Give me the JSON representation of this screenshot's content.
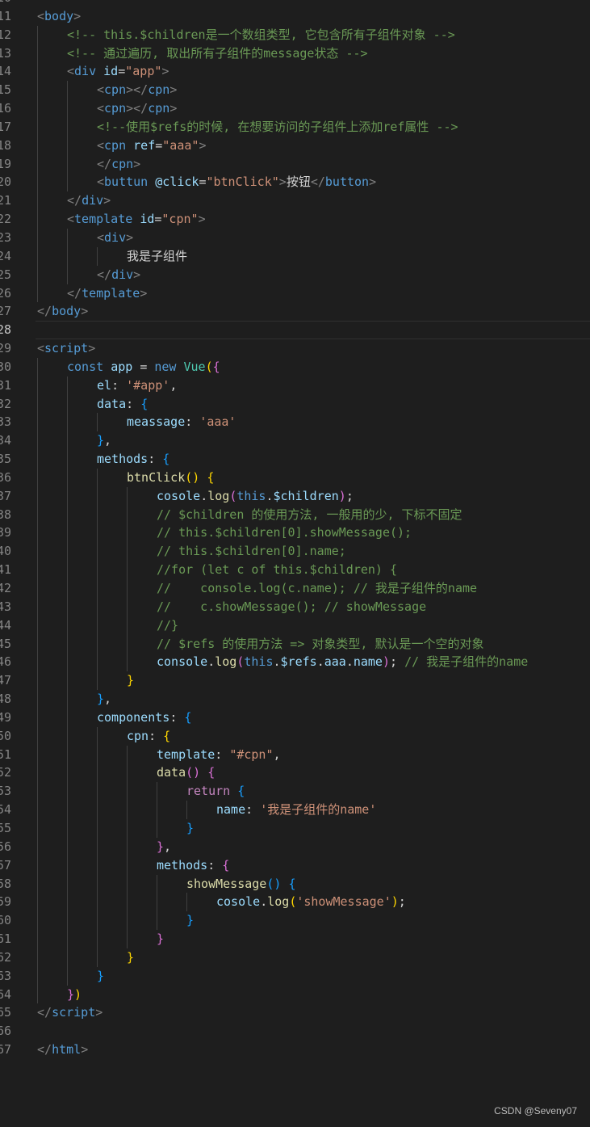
{
  "editor": {
    "language": "html",
    "theme_colors": {
      "background": "#1e1e1e",
      "line_number": "#858585",
      "tag_bracket": "#808080",
      "tag_name": "#569cd6",
      "attribute": "#9cdcfe",
      "string": "#ce9178",
      "comment": "#6a9955",
      "function": "#dcdcaa",
      "bracket_level_1": "#ffd700",
      "bracket_level_2": "#da70d6",
      "bracket_level_3": "#179fff"
    },
    "lines": [
      {
        "n": "10",
        "indent": 0,
        "tokens": []
      },
      {
        "n": "11",
        "indent": 0,
        "tokens": [
          [
            "tag",
            "<"
          ],
          [
            "tn",
            "body"
          ],
          [
            "tag",
            ">"
          ]
        ]
      },
      {
        "n": "12",
        "indent": 1,
        "tokens": [
          [
            "cm",
            "<!-- this.$children是一个数组类型, 它包含所有子组件对象 -->"
          ]
        ]
      },
      {
        "n": "13",
        "indent": 1,
        "tokens": [
          [
            "cm",
            "<!-- 通过遍历, 取出所有子组件的message状态 -->"
          ]
        ]
      },
      {
        "n": "14",
        "indent": 1,
        "tokens": [
          [
            "tag",
            "<"
          ],
          [
            "tn",
            "div"
          ],
          [
            "tx",
            " "
          ],
          [
            "an",
            "id"
          ],
          [
            "pn",
            "="
          ],
          [
            "av",
            "\"app\""
          ],
          [
            "tag",
            ">"
          ]
        ]
      },
      {
        "n": "15",
        "indent": 2,
        "tokens": [
          [
            "tag",
            "<"
          ],
          [
            "tn",
            "cpn"
          ],
          [
            "tag",
            "></"
          ],
          [
            "tn",
            "cpn"
          ],
          [
            "tag",
            ">"
          ]
        ]
      },
      {
        "n": "16",
        "indent": 2,
        "tokens": [
          [
            "tag",
            "<"
          ],
          [
            "tn",
            "cpn"
          ],
          [
            "tag",
            "></"
          ],
          [
            "tn",
            "cpn"
          ],
          [
            "tag",
            ">"
          ]
        ]
      },
      {
        "n": "17",
        "indent": 2,
        "tokens": [
          [
            "cm",
            "<!--使用$refs的时候, 在想要访问的子组件上添加ref属性 -->"
          ]
        ]
      },
      {
        "n": "18",
        "indent": 2,
        "tokens": [
          [
            "tag",
            "<"
          ],
          [
            "tn",
            "cpn"
          ],
          [
            "tx",
            " "
          ],
          [
            "an",
            "ref"
          ],
          [
            "pn",
            "="
          ],
          [
            "av",
            "\"aaa\""
          ],
          [
            "tag",
            ">"
          ]
        ]
      },
      {
        "n": "19",
        "indent": 2,
        "tokens": [
          [
            "tag",
            "</"
          ],
          [
            "tn",
            "cpn"
          ],
          [
            "tag",
            ">"
          ]
        ]
      },
      {
        "n": "20",
        "indent": 2,
        "tokens": [
          [
            "tag",
            "<"
          ],
          [
            "tn",
            "buttun"
          ],
          [
            "tx",
            " "
          ],
          [
            "an",
            "@click"
          ],
          [
            "pn",
            "="
          ],
          [
            "av",
            "\"btnClick\""
          ],
          [
            "tag",
            ">"
          ],
          [
            "tx",
            "按钮"
          ],
          [
            "tag",
            "</"
          ],
          [
            "tn",
            "button"
          ],
          [
            "tag",
            ">"
          ]
        ]
      },
      {
        "n": "21",
        "indent": 1,
        "tokens": [
          [
            "tag",
            "</"
          ],
          [
            "tn",
            "div"
          ],
          [
            "tag",
            ">"
          ]
        ]
      },
      {
        "n": "22",
        "indent": 1,
        "tokens": [
          [
            "tag",
            "<"
          ],
          [
            "tn",
            "template"
          ],
          [
            "tx",
            " "
          ],
          [
            "an",
            "id"
          ],
          [
            "pn",
            "="
          ],
          [
            "av",
            "\"cpn\""
          ],
          [
            "tag",
            ">"
          ]
        ]
      },
      {
        "n": "23",
        "indent": 2,
        "tokens": [
          [
            "tag",
            "<"
          ],
          [
            "tn",
            "div"
          ],
          [
            "tag",
            ">"
          ]
        ]
      },
      {
        "n": "24",
        "indent": 3,
        "tokens": [
          [
            "tx",
            "我是子组件"
          ]
        ]
      },
      {
        "n": "25",
        "indent": 2,
        "tokens": [
          [
            "tag",
            "</"
          ],
          [
            "tn",
            "div"
          ],
          [
            "tag",
            ">"
          ]
        ]
      },
      {
        "n": "26",
        "indent": 1,
        "tokens": [
          [
            "tag",
            "</"
          ],
          [
            "tn",
            "template"
          ],
          [
            "tag",
            ">"
          ]
        ]
      },
      {
        "n": "27",
        "indent": 0,
        "tokens": [
          [
            "tag",
            "</"
          ],
          [
            "tn",
            "body"
          ],
          [
            "tag",
            ">"
          ]
        ]
      },
      {
        "n": "28",
        "indent": 0,
        "active": true,
        "tokens": []
      },
      {
        "n": "29",
        "indent": 0,
        "tokens": [
          [
            "tag",
            "<"
          ],
          [
            "tn",
            "script"
          ],
          [
            "tag",
            ">"
          ]
        ]
      },
      {
        "n": "30",
        "indent": 1,
        "tokens": [
          [
            "kw",
            "const"
          ],
          [
            "tx",
            " "
          ],
          [
            "vr",
            "app"
          ],
          [
            "tx",
            " "
          ],
          [
            "pn",
            "="
          ],
          [
            "tx",
            " "
          ],
          [
            "kw",
            "new"
          ],
          [
            "tx",
            " "
          ],
          [
            "cl",
            "Vue"
          ],
          [
            "b1",
            "("
          ],
          [
            "b2",
            "{"
          ]
        ]
      },
      {
        "n": "31",
        "indent": 2,
        "tokens": [
          [
            "vr",
            "el"
          ],
          [
            "pn",
            ": "
          ],
          [
            "st",
            "'#app'"
          ],
          [
            "pn",
            ","
          ]
        ]
      },
      {
        "n": "32",
        "indent": 2,
        "tokens": [
          [
            "vr",
            "data"
          ],
          [
            "pn",
            ": "
          ],
          [
            "b3",
            "{"
          ]
        ]
      },
      {
        "n": "33",
        "indent": 3,
        "tokens": [
          [
            "vr",
            "meassage"
          ],
          [
            "pn",
            ": "
          ],
          [
            "st",
            "'aaa'"
          ]
        ]
      },
      {
        "n": "34",
        "indent": 2,
        "tokens": [
          [
            "b3",
            "}"
          ],
          [
            "pn",
            ","
          ]
        ]
      },
      {
        "n": "35",
        "indent": 2,
        "tokens": [
          [
            "vr",
            "methods"
          ],
          [
            "pn",
            ": "
          ],
          [
            "b3",
            "{"
          ]
        ]
      },
      {
        "n": "36",
        "indent": 3,
        "tokens": [
          [
            "fn",
            "btnClick"
          ],
          [
            "b1",
            "()"
          ],
          [
            "tx",
            " "
          ],
          [
            "b1",
            "{"
          ]
        ]
      },
      {
        "n": "37",
        "indent": 4,
        "tokens": [
          [
            "vr",
            "cosole"
          ],
          [
            "pn",
            "."
          ],
          [
            "fn",
            "log"
          ],
          [
            "b2",
            "("
          ],
          [
            "kw",
            "this"
          ],
          [
            "pn",
            "."
          ],
          [
            "vr",
            "$children"
          ],
          [
            "b2",
            ")"
          ],
          [
            "pn",
            ";"
          ]
        ]
      },
      {
        "n": "38",
        "indent": 4,
        "tokens": [
          [
            "cm",
            "// $children 的使用方法, 一般用的少, 下标不固定"
          ]
        ]
      },
      {
        "n": "39",
        "indent": 4,
        "tokens": [
          [
            "cm",
            "// this.$children[0].showMessage();"
          ]
        ]
      },
      {
        "n": "40",
        "indent": 4,
        "tokens": [
          [
            "cm",
            "// this.$children[0].name;"
          ]
        ]
      },
      {
        "n": "41",
        "indent": 4,
        "tokens": [
          [
            "cm",
            "//for (let c of this.$children) {"
          ]
        ]
      },
      {
        "n": "42",
        "indent": 4,
        "tokens": [
          [
            "cm",
            "//    console.log(c.name); // 我是子组件的name"
          ]
        ]
      },
      {
        "n": "43",
        "indent": 4,
        "tokens": [
          [
            "cm",
            "//    c.showMessage(); // showMessage"
          ]
        ]
      },
      {
        "n": "44",
        "indent": 4,
        "tokens": [
          [
            "cm",
            "//}"
          ]
        ]
      },
      {
        "n": "45",
        "indent": 4,
        "tokens": [
          [
            "cm",
            "// $refs 的使用方法 => 对象类型, 默认是一个空的对象"
          ]
        ]
      },
      {
        "n": "46",
        "indent": 4,
        "tokens": [
          [
            "vr",
            "console"
          ],
          [
            "pn",
            "."
          ],
          [
            "fn",
            "log"
          ],
          [
            "b2",
            "("
          ],
          [
            "kw",
            "this"
          ],
          [
            "pn",
            "."
          ],
          [
            "vr",
            "$refs"
          ],
          [
            "pn",
            "."
          ],
          [
            "vr",
            "aaa"
          ],
          [
            "pn",
            "."
          ],
          [
            "vr",
            "name"
          ],
          [
            "b2",
            ")"
          ],
          [
            "pn",
            "; "
          ],
          [
            "cm",
            "// 我是子组件的name"
          ]
        ]
      },
      {
        "n": "47",
        "indent": 3,
        "tokens": [
          [
            "b1",
            "}"
          ]
        ]
      },
      {
        "n": "48",
        "indent": 2,
        "tokens": [
          [
            "b3",
            "}"
          ],
          [
            "pn",
            ","
          ]
        ]
      },
      {
        "n": "49",
        "indent": 2,
        "tokens": [
          [
            "vr",
            "components"
          ],
          [
            "pn",
            ": "
          ],
          [
            "b3",
            "{"
          ]
        ]
      },
      {
        "n": "50",
        "indent": 3,
        "tokens": [
          [
            "vr",
            "cpn"
          ],
          [
            "pn",
            ": "
          ],
          [
            "b1",
            "{"
          ]
        ]
      },
      {
        "n": "51",
        "indent": 4,
        "tokens": [
          [
            "vr",
            "template"
          ],
          [
            "pn",
            ": "
          ],
          [
            "st",
            "\"#cpn\""
          ],
          [
            "pn",
            ","
          ]
        ]
      },
      {
        "n": "52",
        "indent": 4,
        "tokens": [
          [
            "fn",
            "data"
          ],
          [
            "b2",
            "()"
          ],
          [
            "tx",
            " "
          ],
          [
            "b2",
            "{"
          ]
        ]
      },
      {
        "n": "53",
        "indent": 5,
        "tokens": [
          [
            "kc",
            "return"
          ],
          [
            "tx",
            " "
          ],
          [
            "b3",
            "{"
          ]
        ]
      },
      {
        "n": "54",
        "indent": 6,
        "tokens": [
          [
            "vr",
            "name"
          ],
          [
            "pn",
            ": "
          ],
          [
            "st",
            "'我是子组件的name'"
          ]
        ]
      },
      {
        "n": "55",
        "indent": 5,
        "tokens": [
          [
            "b3",
            "}"
          ]
        ]
      },
      {
        "n": "56",
        "indent": 4,
        "tokens": [
          [
            "b2",
            "}"
          ],
          [
            "pn",
            ","
          ]
        ]
      },
      {
        "n": "57",
        "indent": 4,
        "tokens": [
          [
            "vr",
            "methods"
          ],
          [
            "pn",
            ": "
          ],
          [
            "b2",
            "{"
          ]
        ]
      },
      {
        "n": "58",
        "indent": 5,
        "tokens": [
          [
            "fn",
            "showMessage"
          ],
          [
            "b3",
            "()"
          ],
          [
            "tx",
            " "
          ],
          [
            "b3",
            "{"
          ]
        ]
      },
      {
        "n": "59",
        "indent": 6,
        "tokens": [
          [
            "vr",
            "cosole"
          ],
          [
            "pn",
            "."
          ],
          [
            "fn",
            "log"
          ],
          [
            "b1",
            "("
          ],
          [
            "st",
            "'showMessage'"
          ],
          [
            "b1",
            ")"
          ],
          [
            "pn",
            ";"
          ]
        ]
      },
      {
        "n": "60",
        "indent": 5,
        "tokens": [
          [
            "b3",
            "}"
          ]
        ]
      },
      {
        "n": "61",
        "indent": 4,
        "tokens": [
          [
            "b2",
            "}"
          ]
        ]
      },
      {
        "n": "62",
        "indent": 3,
        "tokens": [
          [
            "b1",
            "}"
          ]
        ]
      },
      {
        "n": "63",
        "indent": 2,
        "tokens": [
          [
            "b3",
            "}"
          ]
        ]
      },
      {
        "n": "64",
        "indent": 1,
        "tokens": [
          [
            "b2",
            "}"
          ],
          [
            "b1",
            ")"
          ]
        ]
      },
      {
        "n": "65",
        "indent": 0,
        "tokens": [
          [
            "tag",
            "</"
          ],
          [
            "tn",
            "script"
          ],
          [
            "tag",
            ">"
          ]
        ]
      },
      {
        "n": "66",
        "indent": 0,
        "tokens": []
      },
      {
        "n": "67",
        "indent": 0,
        "tokens": [
          [
            "tag",
            "</"
          ],
          [
            "tn",
            "html"
          ],
          [
            "tag",
            ">"
          ]
        ]
      }
    ]
  },
  "watermark": "CSDN @Seveny07"
}
